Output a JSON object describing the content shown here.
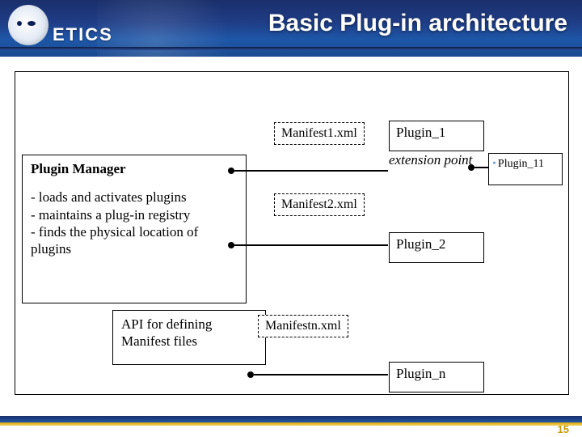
{
  "header": {
    "wordmark": "ETICS",
    "title": "Basic Plug-in architecture"
  },
  "diagram": {
    "plugin_manager": {
      "title": "Plugin Manager",
      "lines": [
        "- loads and activates plugins",
        "- maintains a plug-in registry",
        "- finds the physical location of plugins"
      ]
    },
    "api_box": "API for defining Manifest files",
    "manifests": {
      "m1": "Manifest1.xml",
      "m2": "Manifest2.xml",
      "mn": "Manifestn.xml"
    },
    "plugins": {
      "p1": "Plugin_1",
      "p2": "Plugin_2",
      "pn": "Plugin_n",
      "p11": "Plugin_11"
    },
    "extension_point": "extension point"
  },
  "footer": {
    "page": "15"
  }
}
